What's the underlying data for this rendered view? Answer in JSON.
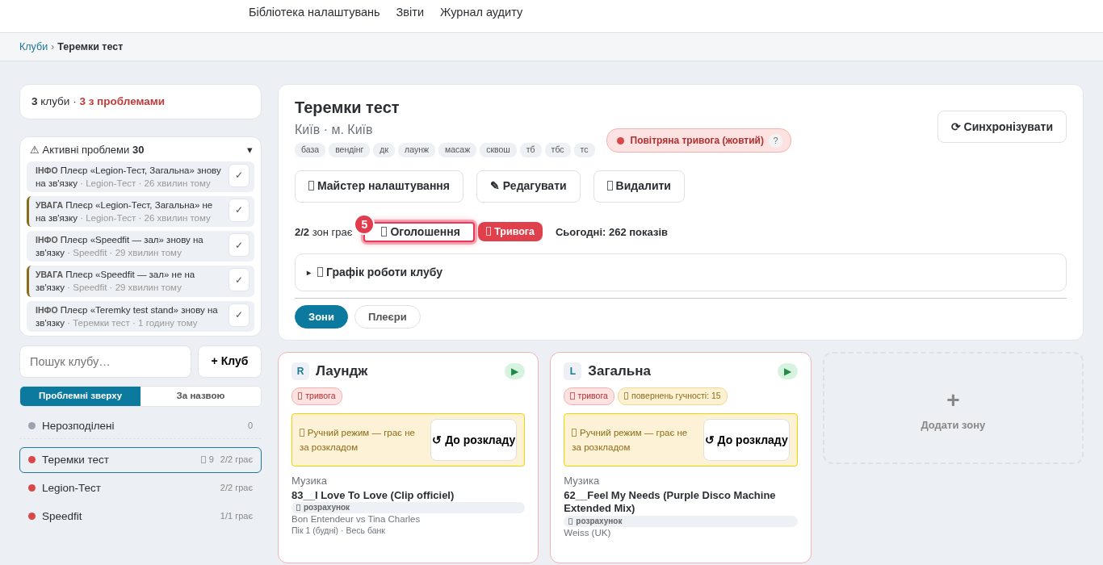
{
  "nav": {
    "links": [
      {
        "label": "Бібліотека налаштувань"
      },
      {
        "label": "Звіти"
      },
      {
        "label": "Журнал аудиту"
      }
    ]
  },
  "breadcrumb": [
    {
      "label": "Клуби",
      "kind": "link"
    },
    {
      "label": "›",
      "kind": "separator"
    },
    {
      "label": "Теремки тест",
      "kind": "current"
    }
  ],
  "summary": {
    "count": "3",
    "count_label": "клуби",
    "separator": "·",
    "problems": "3 з проблемами"
  },
  "problems": {
    "icon": "⚠",
    "title": "Активні проблеми",
    "count": "30",
    "caret": "▾",
    "expanded": true,
    "items": [
      {
        "kind": "info",
        "level_label": "ІНФО",
        "text": "Плеєр «Legion-Тест, Загальна» знову на зв'язку",
        "meta": "· Legion-Тест · 26 хвилин тому",
        "action": "✓"
      },
      {
        "kind": "warning",
        "level_label": "УВАГА",
        "text": "Плеєр «Legion-Тест, Загальна» не на зв'язку",
        "meta": "· Legion-Тест · 26 хвилин тому",
        "action": "✓"
      },
      {
        "kind": "info",
        "level_label": "ІНФО",
        "text": "Плеєр «Speedfit — зал» знову на зв'язку",
        "meta": "· Speedfit · 29 хвилин тому",
        "action": "✓"
      },
      {
        "kind": "warning",
        "level_label": "УВАГА",
        "text": "Плеєр «Speedfit — зал» не на зв'язку",
        "meta": "· Speedfit · 29 хвилин тому",
        "action": "✓"
      },
      {
        "kind": "info",
        "level_label": "ІНФО",
        "text": "Плеєр «Teremky test stand» знову на зв'язку",
        "meta": "· Теремки тест · 1 годину тому",
        "action": "✓"
      }
    ]
  },
  "search": {
    "placeholder": "Пошук клубу…"
  },
  "add_club_button": "+ Клуб",
  "sort": [
    {
      "label": "Проблемні зверху",
      "selected": true
    },
    {
      "label": "За назвою",
      "selected": false
    }
  ],
  "unassigned": {
    "name": "Нерозподілені",
    "count": "0",
    "color": "#9aa3ae"
  },
  "clubs": [
    {
      "name": "Теремки тест",
      "color": "#d94848",
      "selected": true,
      "alerts": "9",
      "playing": "2/2 грає"
    },
    {
      "name": "Legion-Тест",
      "color": "#d94848",
      "selected": false,
      "playing": "2/2 грає"
    },
    {
      "name": "Speedfit",
      "color": "#d94848",
      "selected": false,
      "playing": "1/1 грає"
    }
  ],
  "club": {
    "title": "Теремки тест",
    "location": "Київ · м. Київ",
    "tags": [
      "база",
      "вендінг",
      "дк",
      "лаунж",
      "масаж",
      "сквош",
      "тб",
      "тбс",
      "тс"
    ],
    "alert_badge": {
      "label": "Повітряна тривога (жовтий)",
      "help": "?",
      "color": "#d94848"
    },
    "sync_button": "⟳ Синхронізувати",
    "actions": [
      {
        "label": "Майстер налаштування",
        "missing_icon": true
      },
      {
        "label": "✎ Редагувати",
        "missing_icon": false
      },
      {
        "label": "Видалити",
        "missing_icon": true
      }
    ],
    "zones_playing": "2/2",
    "zones_playing_label": "зон грає",
    "announcement_button": {
      "label": "Оголошення",
      "missing_icon": true,
      "badge": "5",
      "highlighted": true
    },
    "alarm_button": {
      "label": "Тривога",
      "missing_icon": true
    },
    "today": "Сьогодні: 262 показів",
    "schedule": {
      "caret": "▸",
      "label": "Графік роботи клубу",
      "missing_icon": true,
      "expanded": false
    },
    "view_tabs": [
      {
        "label": "Зони",
        "selected": true
      },
      {
        "label": "Плеєри",
        "selected": false
      }
    ]
  },
  "zones": [
    {
      "letter": "R",
      "name": "Лаундж",
      "playing": true,
      "play_icon": "▶",
      "tags": [
        {
          "kind": "alarm",
          "label": "тривога"
        }
      ],
      "manual": {
        "text": "Ручний режим — грає не за розкладом",
        "button": "↺ До розкладу"
      },
      "music_label": "Музика",
      "track": "83__I Love To Love (Clip officiel)",
      "source_tag": "розрахунок",
      "artist": "Bon Entendeur vs Tina Charles",
      "schedule": "Пік 1 (будні) · Весь банк"
    },
    {
      "letter": "L",
      "name": "Загальна",
      "playing": true,
      "play_icon": "▶",
      "tags": [
        {
          "kind": "alarm",
          "label": "тривога"
        },
        {
          "kind": "warning",
          "label": "повернень гучності: 15"
        }
      ],
      "manual": {
        "text": "Ручний режим — грає не за розкладом",
        "button": "↺ До розкладу"
      },
      "music_label": "Музика",
      "track": "62__Feel My Needs (Purple Disco Machine Extended Mix)",
      "source_tag": "розрахунок",
      "artist": "Weiss (UK)"
    }
  ],
  "add_zone": {
    "icon": "+",
    "label": "Додати зону"
  }
}
